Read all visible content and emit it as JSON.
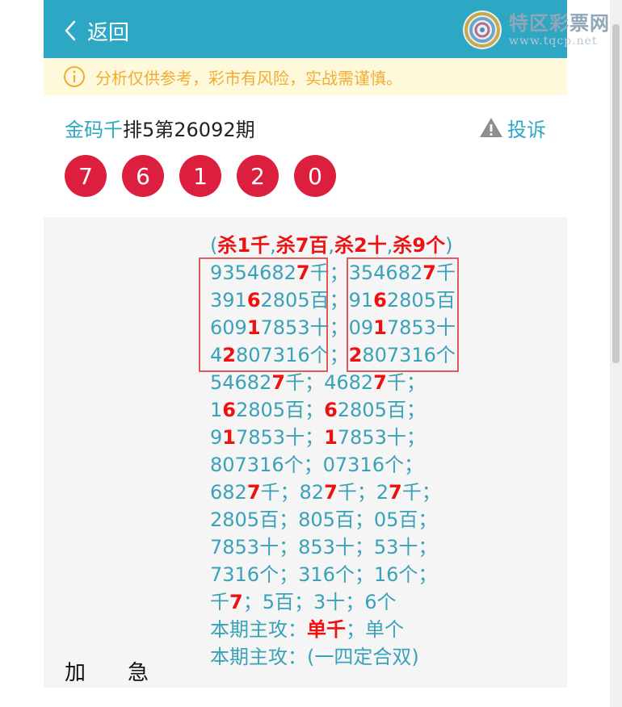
{
  "header": {
    "back_label": "返回"
  },
  "logo": {
    "title": "特区彩票网",
    "url": "www.tqcp.net"
  },
  "notice": {
    "text": "分析仅供参考，彩市有风险，实战需谨慎。"
  },
  "title": {
    "author": "金码千",
    "rest": "排5第26092期"
  },
  "complain_label": "投诉",
  "balls": [
    "7",
    "6",
    "1",
    "2",
    "0"
  ],
  "label": {
    "a": "加",
    "b": "急"
  },
  "lines": [
    [
      [
        "(",
        0
      ],
      [
        "杀1千",
        1
      ],
      [
        ",",
        0
      ],
      [
        "杀7百",
        1
      ],
      [
        ",",
        0
      ],
      [
        "杀2十",
        1
      ],
      [
        ",",
        0
      ],
      [
        "杀9个",
        1
      ],
      [
        ")",
        0
      ]
    ],
    [
      [
        "935468",
        0
      ],
      [
        "2",
        0
      ],
      [
        "7",
        1
      ],
      [
        "千；",
        0
      ],
      [
        "354682",
        0
      ],
      [
        "7",
        1
      ],
      [
        "千",
        0
      ]
    ],
    [
      [
        "391",
        0
      ],
      [
        "6",
        1
      ],
      [
        "2805百；",
        0
      ],
      [
        "91",
        0
      ],
      [
        "6",
        1
      ],
      [
        "2805百",
        0
      ]
    ],
    [
      [
        "609",
        0
      ],
      [
        "1",
        1
      ],
      [
        "7853十；",
        0
      ],
      [
        "09",
        0
      ],
      [
        "1",
        1
      ],
      [
        "7853十",
        0
      ]
    ],
    [
      [
        "4",
        0
      ],
      [
        "2",
        1
      ],
      [
        "807316个；",
        0
      ],
      [
        "2",
        1
      ],
      [
        "807316个",
        0
      ]
    ],
    [
      [
        "54682",
        0
      ],
      [
        "7",
        1
      ],
      [
        "千；",
        0
      ],
      [
        "4682",
        0
      ],
      [
        "7",
        1
      ],
      [
        "千；",
        0
      ]
    ],
    [
      [
        "1",
        0
      ],
      [
        "6",
        1
      ],
      [
        "2805百；",
        0
      ],
      [
        "6",
        1
      ],
      [
        "2805百；",
        0
      ]
    ],
    [
      [
        "9",
        0
      ],
      [
        "1",
        1
      ],
      [
        "7853十；",
        0
      ],
      [
        "1",
        1
      ],
      [
        "7853十；",
        0
      ]
    ],
    [
      [
        "807316个；",
        0
      ],
      [
        "07316个；",
        0
      ]
    ],
    [
      [
        "682",
        0
      ],
      [
        "7",
        1
      ],
      [
        "千；",
        0
      ],
      [
        "82",
        0
      ],
      [
        "7",
        1
      ],
      [
        "千；",
        0
      ],
      [
        "2",
        0
      ],
      [
        "7",
        1
      ],
      [
        "千；",
        0
      ]
    ],
    [
      [
        "2805百；",
        0
      ],
      [
        "805百；",
        0
      ],
      [
        "05百；",
        0
      ]
    ],
    [
      [
        "7853十；",
        0
      ],
      [
        "853十；",
        0
      ],
      [
        "53十；",
        0
      ]
    ],
    [
      [
        "7316个；",
        0
      ],
      [
        "316个；",
        0
      ],
      [
        "16个；",
        0
      ]
    ],
    [
      [
        "千",
        0
      ],
      [
        "7",
        1
      ],
      [
        "；",
        0
      ],
      [
        "5百；",
        0
      ],
      [
        "3十；",
        0
      ],
      [
        "6个",
        0
      ]
    ],
    [
      [
        "本期主攻：",
        0
      ],
      [
        "单千",
        1
      ],
      [
        "；单个",
        0
      ]
    ],
    [
      [
        "本期主攻：(一四定合双)",
        0
      ]
    ]
  ],
  "colors": {
    "header": "#2ea7c4",
    "ball": "#dd1f3f",
    "highlight": "#ee1111",
    "text": "#3aa2b8",
    "notice_bg": "#fff9dc",
    "notice_text": "#f0ad35"
  }
}
